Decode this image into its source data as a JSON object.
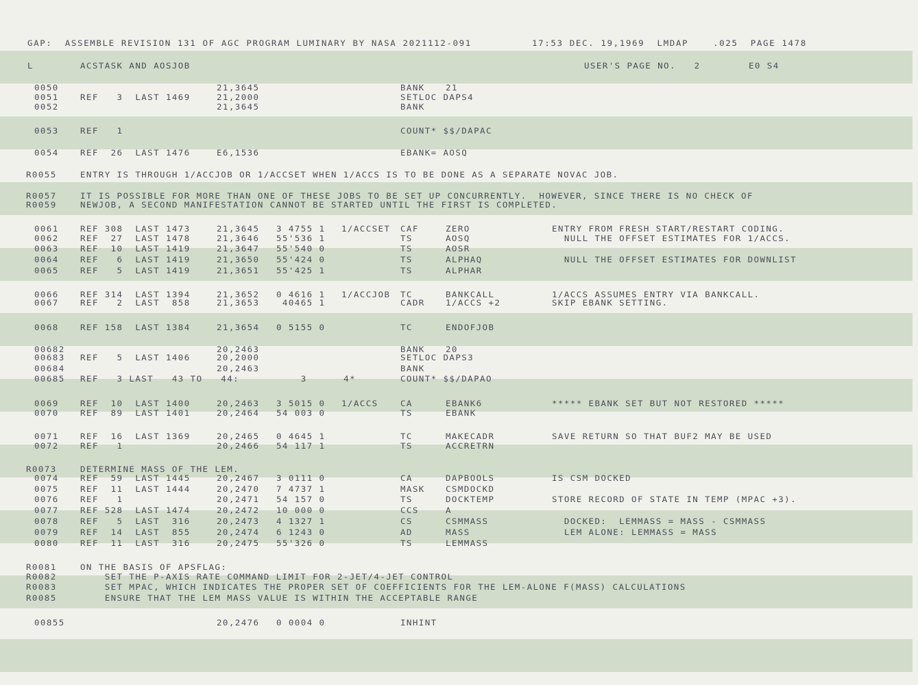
{
  "header": {
    "line1": "GAP:  ASSEMBLE REVISION 131 OF AGC PROGRAM LUMINARY BY NASA 2021112-091",
    "timestamp": "17:53 DEC. 19,1969  LMDAP",
    "page_info": ".025  PAGE 1478",
    "log_marker": "L",
    "log_title": "ACSTASK AND AOSJOB",
    "users_page": "USER'S PAGE NO.   2",
    "eo_label": "E0 S4"
  },
  "rows": [
    {
      "line": "0050",
      "assign": "21,3645",
      "inst": "BANK",
      "operand": "21"
    },
    {
      "line": "0051",
      "ref": "REF   3  LAST 1469",
      "assign": "21,2000",
      "inst": "SETLOC DAPS4"
    },
    {
      "line": "0052",
      "assign": "21,3645",
      "inst": "BANK"
    },
    {
      "line": "0053",
      "ref": "REF   1",
      "inst": "COUNT* $$/DAPAC"
    },
    {
      "line": "0054",
      "ref": "REF  26  LAST 1476",
      "assign": "E6,1536",
      "inst": "EBANK= AOSQ"
    },
    {
      "line": "R0055",
      "text": "ENTRY IS THROUGH 1/ACCJOB OR 1/ACCSET WHEN 1/ACCS IS TO BE DONE AS A SEPARATE NOVAC JOB."
    },
    {
      "line": "R0057",
      "text": "IT IS POSSIBLE FOR MORE THAN ONE OF THESE JOBS TO BE SET UP CONCURRENTLY.  HOWEVER, SINCE THERE IS NO CHECK OF"
    },
    {
      "line": "R0059",
      "text": "NEWJOB, A SECOND MANIFESTATION CANNOT BE STARTED UNTIL THE FIRST IS COMPLETED."
    },
    {
      "line": "0061",
      "ref": "REF 308  LAST 1473",
      "assign": "21,3645",
      "code": "3 4755 1",
      "label": "1/ACCSET",
      "inst": "CAF",
      "operand": "ZERO",
      "comment": "ENTRY FROM FRESH START/RESTART CODING."
    },
    {
      "line": "0062",
      "ref": "REF  27  LAST 1478",
      "assign": "21,3646",
      "code": "55'536 1",
      "inst": "TS",
      "operand": "AOSQ",
      "comment": "  NULL THE OFFSET ESTIMATES FOR 1/ACCS."
    },
    {
      "line": "0063",
      "ref": "REF  10  LAST 1419",
      "assign": "21,3647",
      "code": "55'540 0",
      "inst": "TS",
      "operand": "AOSR"
    },
    {
      "line": "0064",
      "ref": "REF   6  LAST 1419",
      "assign": "21,3650",
      "code": "55'424 0",
      "inst": "TS",
      "operand": "ALPHAQ",
      "comment": "  NULL THE OFFSET ESTIMATES FOR DOWNLIST"
    },
    {
      "line": "0065",
      "ref": "REF   5  LAST 1419",
      "assign": "21,3651",
      "code": "55'425 1",
      "inst": "TS",
      "operand": "ALPHAR"
    },
    {
      "line": "0066",
      "ref": "REF 314  LAST 1394",
      "assign": "21,3652",
      "code": "0 4616 1",
      "label": "1/ACCJOB",
      "inst": "TC",
      "operand": "BANKCALL",
      "comment": "1/ACCS ASSUMES ENTRY VIA BANKCALL."
    },
    {
      "line": "0067",
      "ref": "REF   2  LAST  858",
      "assign": "21,3653",
      "code": " 40465 1",
      "inst": "CADR",
      "operand": "1/ACCS +2",
      "comment": "SKIP EBANK SETTING."
    },
    {
      "line": "0068",
      "ref": "REF 158  LAST 1384",
      "assign": "21,3654",
      "code": "0 5155 0",
      "inst": "TC",
      "operand": "ENDOFJOB"
    },
    {
      "line": "00682",
      "assign": "20,2463",
      "inst": "BANK",
      "operand": "20"
    },
    {
      "line": "00683",
      "ref": "REF   5  LAST 1406",
      "assign": "20,2000",
      "inst": "SETLOC DAPS3"
    },
    {
      "line": "00684",
      "assign": "20,2463",
      "inst": "BANK"
    },
    {
      "line": "00685",
      "ref": "REF   3 LAST   43 TO   44:",
      "code": "    3      4*",
      "inst": "COUNT* $$/DAPAO"
    },
    {
      "line": "0069",
      "ref": "REF  10  LAST 1400",
      "assign": "20,2463",
      "code": "3 5015 0",
      "label": "1/ACCS",
      "inst": "CA",
      "operand": "EBANK6",
      "comment": "***** EBANK SET BUT NOT RESTORED *****"
    },
    {
      "line": "0070",
      "ref": "REF  89  LAST 1401",
      "assign": "20,2464",
      "code": "54 003 0",
      "inst": "TS",
      "operand": "EBANK"
    },
    {
      "line": "0071",
      "ref": "REF  16  LAST 1369",
      "assign": "20,2465",
      "code": "0 4645 1",
      "inst": "TC",
      "operand": "MAKECADR",
      "comment": "SAVE RETURN SO THAT BUF2 MAY BE USED"
    },
    {
      "line": "0072",
      "ref": "REF   1",
      "assign": "20,2466",
      "code": "54 117 1",
      "inst": "TS",
      "operand": "ACCRETRN"
    },
    {
      "line": "R0073",
      "text": "DETERMINE MASS OF THE LEM."
    },
    {
      "line": "0074",
      "ref": "REF  59  LAST 1445",
      "assign": "20,2467",
      "code": "3 0111 0",
      "inst": "CA",
      "operand": "DAPBOOLS",
      "comment": "IS CSM DOCKED"
    },
    {
      "line": "0075",
      "ref": "REF  11  LAST 1444",
      "assign": "20,2470",
      "code": "7 4737 1",
      "inst": "MASK",
      "operand": "CSMDOCKD"
    },
    {
      "line": "0076",
      "ref": "REF   1",
      "assign": "20,2471",
      "code": "54 157 0",
      "inst": "TS",
      "operand": "DOCKTEMP",
      "comment": "STORE RECORD OF STATE IN TEMP (MPAC +3)."
    },
    {
      "line": "0077",
      "ref": "REF 528  LAST 1474",
      "assign": "20,2472",
      "code": "10 000 0",
      "inst": "CCS",
      "operand": "A"
    },
    {
      "line": "0078",
      "ref": "REF   5  LAST  316",
      "assign": "20,2473",
      "code": "4 1327 1",
      "inst": "CS",
      "operand": "CSMMASS",
      "comment": "  DOCKED:  LEMMASS = MASS - CSMMASS"
    },
    {
      "line": "0079",
      "ref": "REF  14  LAST  855",
      "assign": "20,2474",
      "code": "6 1243 0",
      "inst": "AD",
      "operand": "MASS",
      "comment": "  LEM ALONE: LEMMASS = MASS"
    },
    {
      "line": "0080",
      "ref": "REF  11  LAST  316",
      "assign": "20,2475",
      "code": "55'326 0",
      "inst": "TS",
      "operand": "LEMMASS"
    },
    {
      "line": "R0081",
      "text": "ON THE BASIS OF APSFLAG:"
    },
    {
      "line": "R0082",
      "text": "    SET THE P-AXIS RATE COMMAND LIMIT FOR 2-JET/4-JET CONTROL"
    },
    {
      "line": "R0083",
      "text": "    SET MPAC, WHICH INDICATES THE PROPER SET OF COEFFICIENTS FOR THE LEM-ALONE F(MASS) CALCULATIONS"
    },
    {
      "line": "R0085",
      "text": "    ENSURE THAT THE LEM MASS VALUE IS WITHIN THE ACCEPTABLE RANGE"
    },
    {
      "line": "00855",
      "assign": "20,2476",
      "code": "0 0004 0",
      "inst": "INHINT"
    }
  ]
}
